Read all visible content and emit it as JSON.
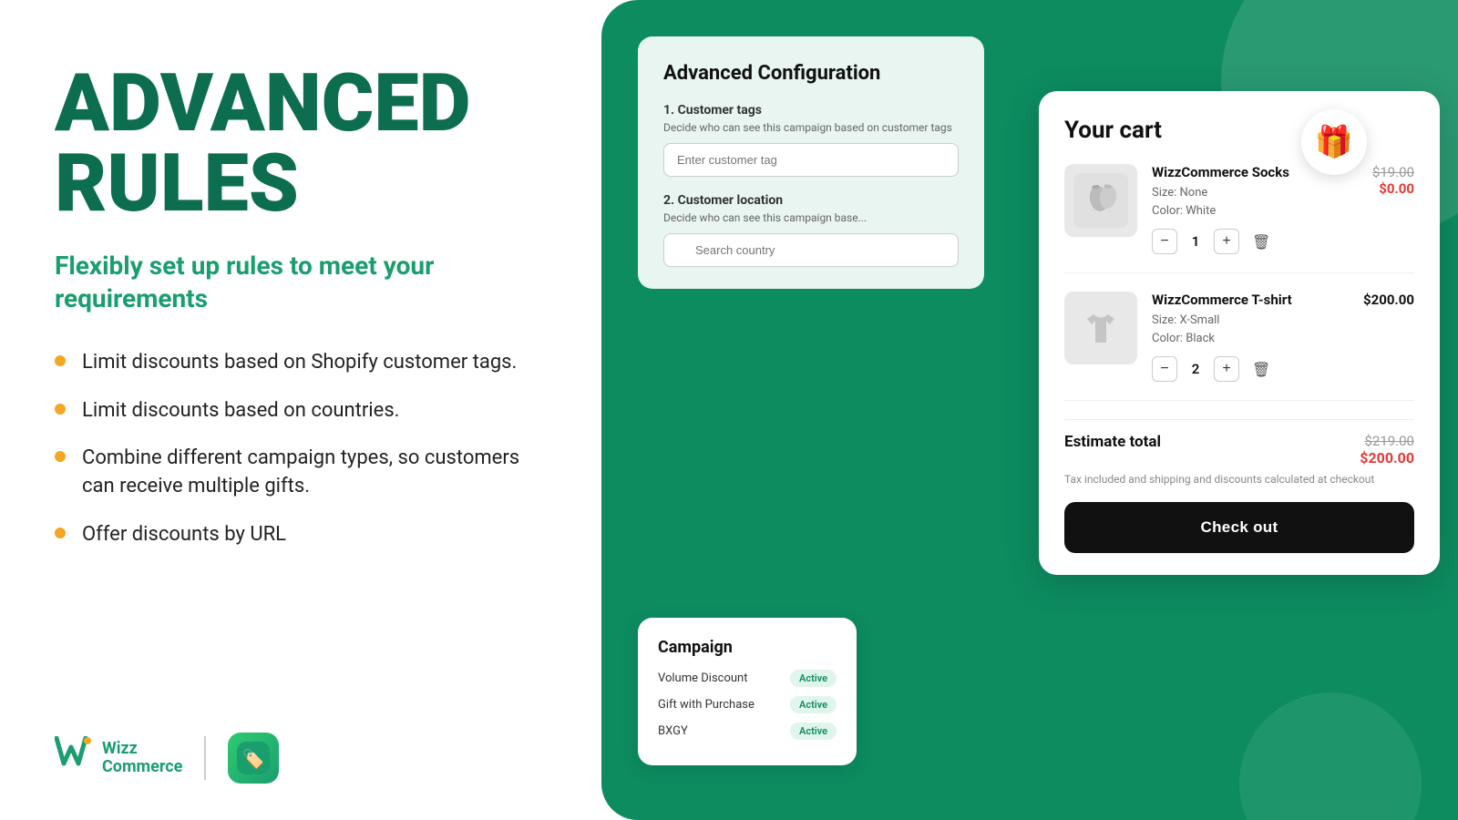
{
  "left": {
    "title_line1": "ADVANCED",
    "title_line2": "RULES",
    "subtitle": "Flexibly set up rules to meet your requirements",
    "bullets": [
      "Limit discounts based on Shopify customer tags.",
      "Limit discounts based on countries.",
      "Combine different campaign types, so customers can receive multiple gifts.",
      "Offer discounts by URL"
    ],
    "logo": {
      "brand": "Wizz",
      "brand2": "Commerce"
    }
  },
  "config_card": {
    "title": "Advanced Configuration",
    "section1_title": "1. Customer tags",
    "section1_desc": "Decide who can see this campaign based on customer tags",
    "section1_placeholder": "Enter customer tag",
    "section2_title": "2. Customer location",
    "section2_desc": "Decide who can see this campaign base...",
    "section2_placeholder": "Search country"
  },
  "campaign_card": {
    "title": "Campaign",
    "items": [
      {
        "name": "Volume Discount",
        "badge": "Active"
      },
      {
        "name": "Gift with Purchase",
        "badge": "Active"
      },
      {
        "name": "BXGY",
        "badge": "Active"
      }
    ]
  },
  "cart": {
    "title": "Your cart",
    "items": [
      {
        "name": "WizzCommerce Socks",
        "size": "None",
        "color": "White",
        "price_original": "$19.00",
        "price_discounted": "$0.00",
        "quantity": 1,
        "type": "socks"
      },
      {
        "name": "WizzCommerce T-shirt",
        "size": "X-Small",
        "color": "Black",
        "price_normal": "$200.00",
        "quantity": 2,
        "type": "tshirt"
      }
    ],
    "estimate_label": "Estimate total",
    "estimate_original": "$219.00",
    "estimate_discounted": "$200.00",
    "tax_note": "Tax included and shipping and discounts calculated at checkout",
    "checkout_label": "Check out"
  },
  "gift_emoji": "🎁"
}
